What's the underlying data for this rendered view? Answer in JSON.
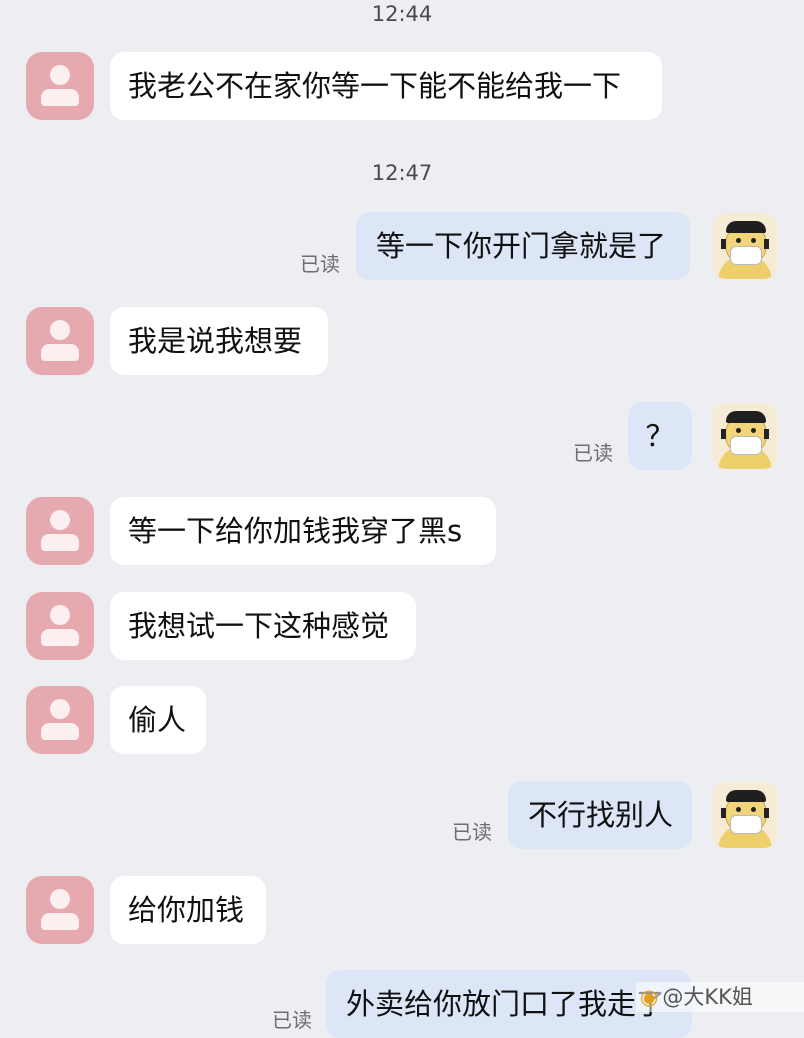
{
  "timestamps": [
    "12:44",
    "12:47"
  ],
  "read_label": "已读",
  "messages": [
    {
      "side": "left",
      "text": "我老公不在家你等一下能不能给我一下"
    },
    {
      "side": "right",
      "text": "等一下你开门拿就是了"
    },
    {
      "side": "left",
      "text": "我是说我想要"
    },
    {
      "side": "right",
      "text": "？"
    },
    {
      "side": "left",
      "text": "等一下给你加钱我穿了黑s"
    },
    {
      "side": "left",
      "text": "我想试一下这种感觉"
    },
    {
      "side": "left",
      "text": "偷人"
    },
    {
      "side": "right",
      "text": "不行找别人"
    },
    {
      "side": "left",
      "text": "给你加钱"
    },
    {
      "side": "right",
      "text": "外卖给你放门口了我走了"
    }
  ],
  "partial_read_label": "已读",
  "watermark": {
    "text": "@大KK姐",
    "icon": "weibo-icon"
  },
  "colors": {
    "background": "#eceef2",
    "left_bubble": "#ffffff",
    "right_bubble": "#dde6f7",
    "left_avatar": "#e7a9b0"
  }
}
